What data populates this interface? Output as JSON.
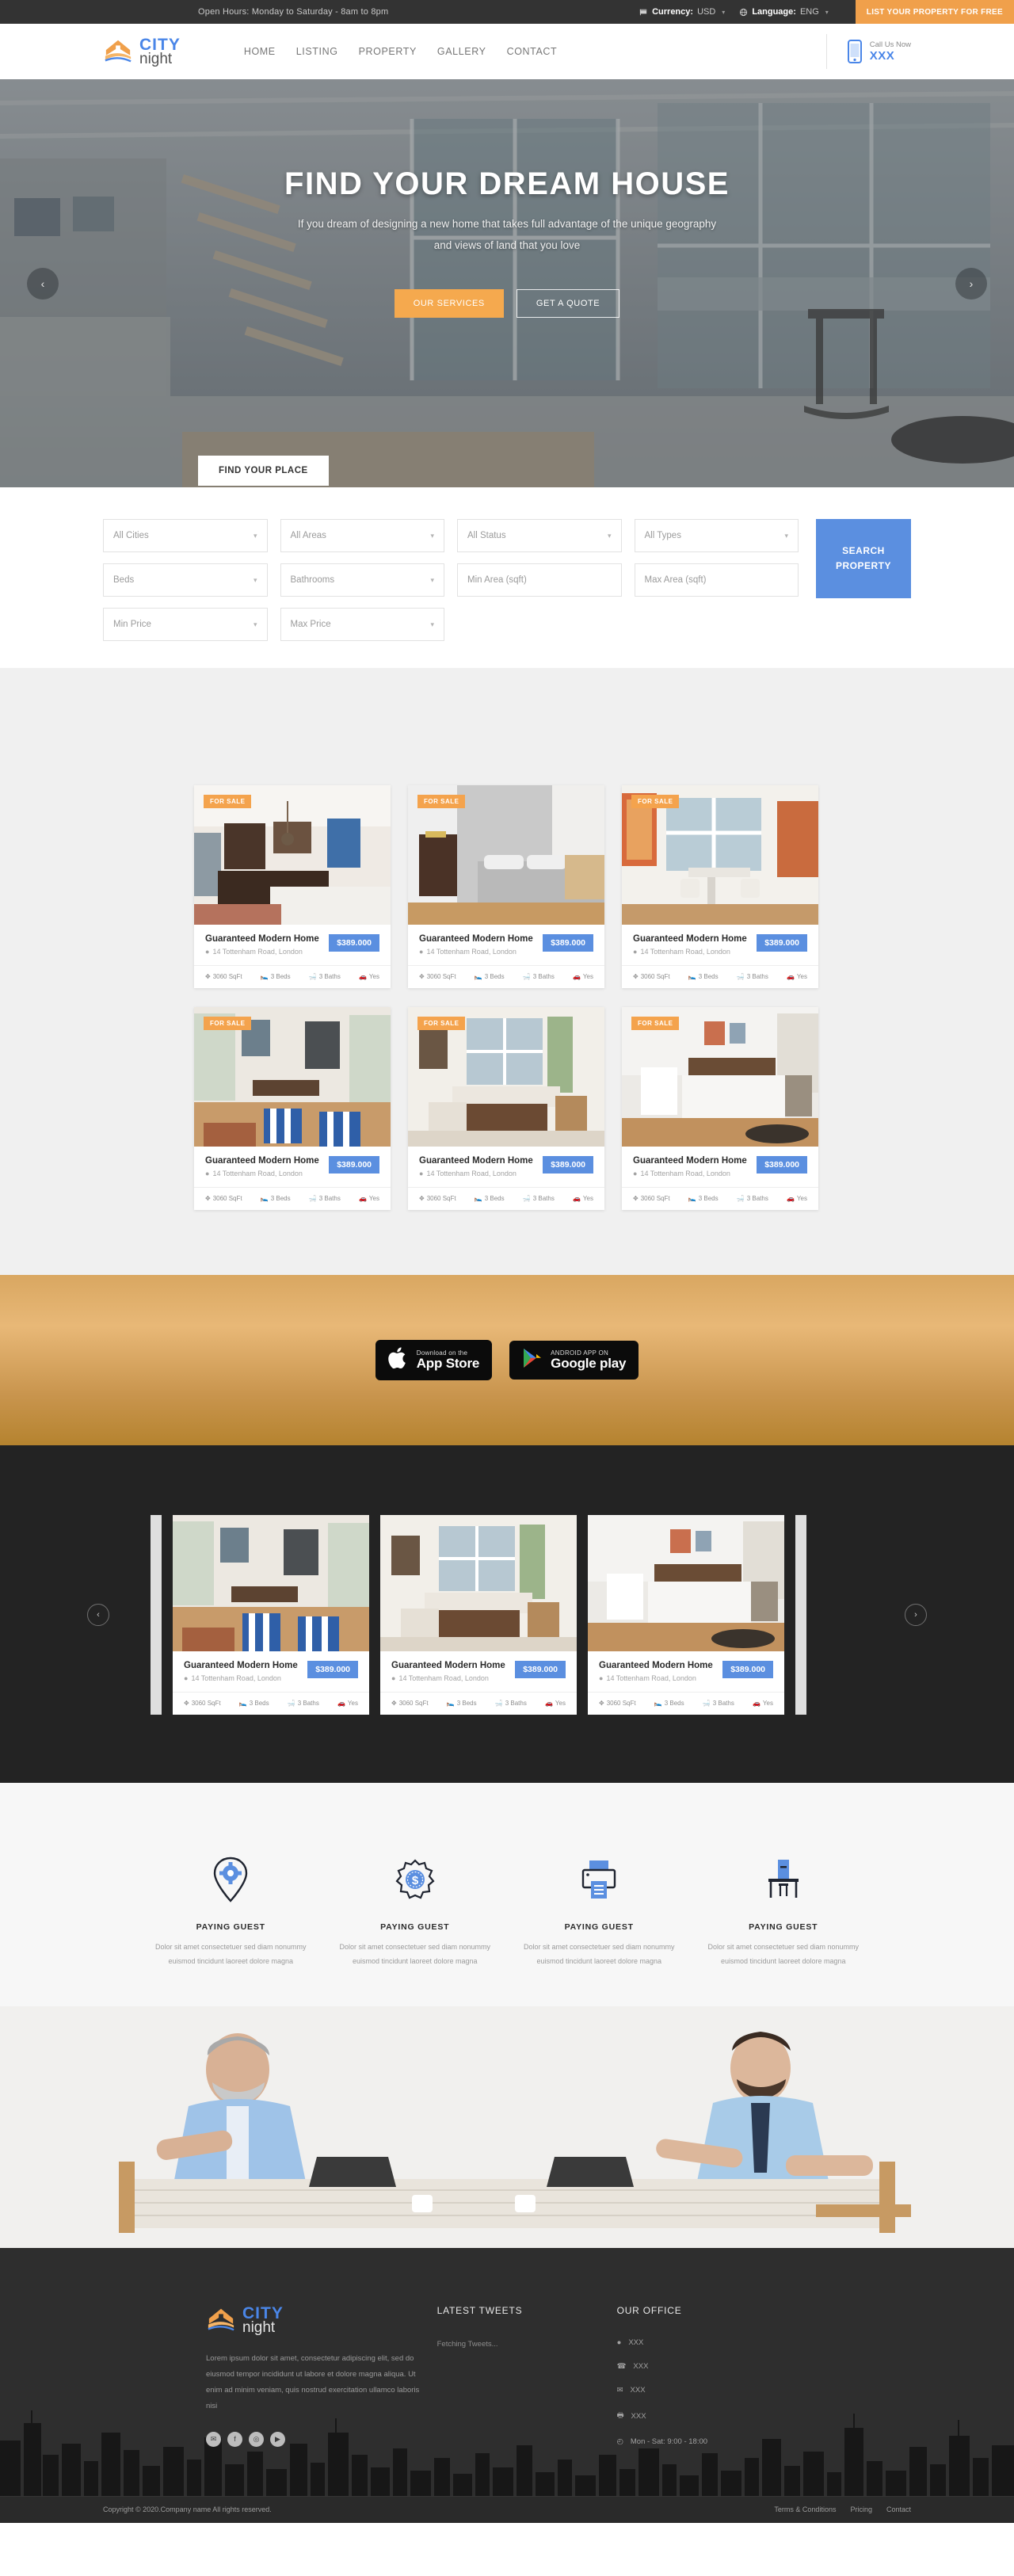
{
  "topbar": {
    "hours": "Open Hours: Monday to Saturday - 8am to 8pm",
    "currency_label": "Currency:",
    "currency_value": "USD",
    "language_label": "Language:",
    "language_value": "ENG",
    "cta": "LIST YOUR PROPERTY FOR FREE",
    "accent": "#f0a04b"
  },
  "header": {
    "logo_city": "CITY",
    "logo_night": "night",
    "nav": [
      {
        "label": "HOME"
      },
      {
        "label": "LISTING"
      },
      {
        "label": "PROPERTY"
      },
      {
        "label": "GALLERY"
      },
      {
        "label": "CONTACT"
      }
    ],
    "call_label": "Call Us Now",
    "call_number": "XXX",
    "accent": "#4a86e8"
  },
  "hero": {
    "title": "FIND YOUR DREAM HOUSE",
    "subtitle": "If you dream of designing a new home that takes full advantage of the unique geography and views of land that you love",
    "btn_primary": "OUR SERVICES",
    "btn_secondary": "GET A QUOTE",
    "prev": "‹",
    "next": "›"
  },
  "search": {
    "tab_label": "FIND YOUR PLACE",
    "fields": [
      {
        "label": "All Cities",
        "type": "select"
      },
      {
        "label": "All Areas",
        "type": "select"
      },
      {
        "label": "All Status",
        "type": "select"
      },
      {
        "label": "All Types",
        "type": "select"
      },
      {
        "label": "Beds",
        "type": "select"
      },
      {
        "label": "Bathrooms",
        "type": "select"
      },
      {
        "label": "Min Area (sqft)",
        "type": "text"
      },
      {
        "label": "Max Area (sqft)",
        "type": "text"
      },
      {
        "label": "Min Price",
        "type": "select"
      },
      {
        "label": "Max Price",
        "type": "select"
      }
    ],
    "button": "SEARCH PROPERTY",
    "button_color": "#5b8fe0"
  },
  "listing": {
    "badge": "FOR SALE",
    "title": "Guaranteed Modern Home",
    "address": "14 Tottenham Road, London",
    "price": "$389.000",
    "sqft": "3060 SqFt",
    "beds": "3 Beds",
    "baths": "3 Baths",
    "garage": "Yes",
    "cards": [
      {
        "photo": "kitchen"
      },
      {
        "photo": "bedroom-grey"
      },
      {
        "photo": "dining-window"
      },
      {
        "photo": "living-striped"
      },
      {
        "photo": "living-classic"
      },
      {
        "photo": "bedroom-white"
      }
    ]
  },
  "appband": {
    "apple_small": "Download on the",
    "apple_large": "App Store",
    "google_small": "ANDROID APP ON",
    "google_large": "Google play"
  },
  "carousel": {
    "cards": [
      {
        "photo": "living-striped"
      },
      {
        "photo": "living-classic"
      },
      {
        "photo": "bedroom-white"
      }
    ],
    "prev": "‹",
    "next": "›"
  },
  "features": {
    "items": [
      {
        "icon": "map-pin-gear-icon",
        "title": "PAYING GUEST",
        "desc": "Dolor sit amet consectetuer sed diam nonummy euismod tincidunt laoreet dolore magna"
      },
      {
        "icon": "badge-dollar-icon",
        "title": "PAYING GUEST",
        "desc": "Dolor sit amet consectetuer sed diam nonummy euismod tincidunt laoreet dolore magna"
      },
      {
        "icon": "printer-icon",
        "title": "PAYING GUEST",
        "desc": "Dolor sit amet consectetuer sed diam nonummy euismod tincidunt laoreet dolore magna"
      },
      {
        "icon": "desk-chair-icon",
        "title": "PAYING GUEST",
        "desc": "Dolor sit amet consectetuer sed diam nonummy euismod tincidunt laoreet dolore magna"
      }
    ]
  },
  "footer": {
    "logo_city": "CITY",
    "logo_night": "night",
    "about": "Lorem ipsum dolor sit amet, consectetur adipiscing elit, sed do eiusmod tempor incididunt ut labore et dolore magna aliqua. Ut enim ad minim veniam, quis nostrud exercitation ullamco laboris nisi",
    "socials": [
      {
        "icon": "twitter-icon",
        "glyph": "✉"
      },
      {
        "icon": "facebook-icon",
        "glyph": "f"
      },
      {
        "icon": "instagram-icon",
        "glyph": "◎"
      },
      {
        "icon": "youtube-icon",
        "glyph": "▶"
      }
    ],
    "tweets_head": "LATEST TWEETS",
    "tweets_body": "Fetching Tweets...",
    "office_head": "OUR OFFICE",
    "office": [
      {
        "icon": "location-icon",
        "value": "XXX"
      },
      {
        "icon": "phone-icon",
        "value": "XXX"
      },
      {
        "icon": "mail-icon",
        "value": "XXX"
      },
      {
        "icon": "printer-icon",
        "value": "XXX"
      },
      {
        "icon": "clock-icon",
        "value": "Mon - Sat: 9:00 - 18:00"
      }
    ],
    "copyright": "Copyright © 2020.Company name All rights reserved.",
    "links": [
      {
        "label": "Terms & Conditions"
      },
      {
        "label": "Pricing"
      },
      {
        "label": "Contact"
      }
    ]
  }
}
